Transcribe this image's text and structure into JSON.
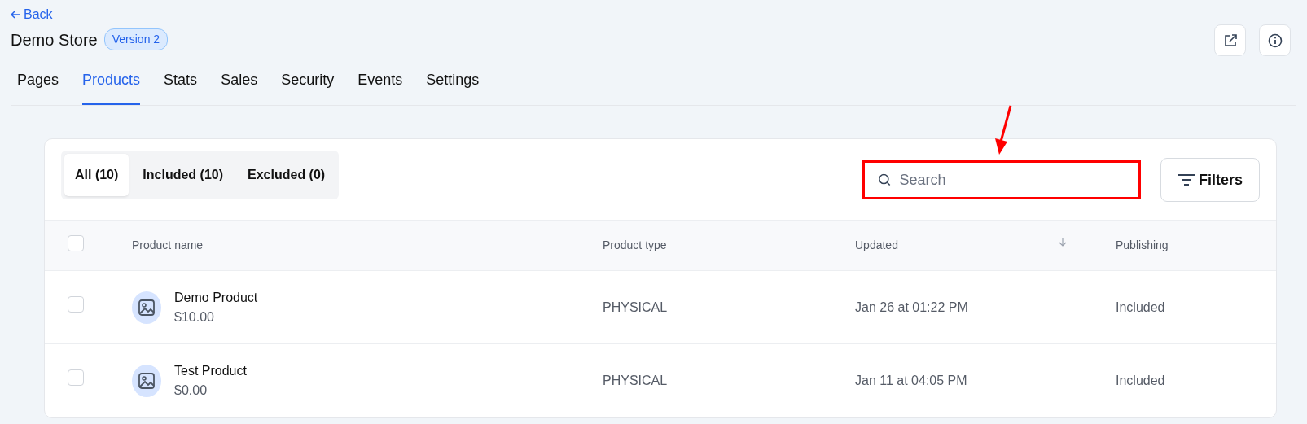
{
  "back_link": "Back",
  "store": {
    "title": "Demo Store",
    "version_badge": "Version 2"
  },
  "tabs": [
    {
      "label": "Pages",
      "selected": false
    },
    {
      "label": "Products",
      "selected": true
    },
    {
      "label": "Stats",
      "selected": false
    },
    {
      "label": "Sales",
      "selected": false
    },
    {
      "label": "Security",
      "selected": false
    },
    {
      "label": "Events",
      "selected": false
    },
    {
      "label": "Settings",
      "selected": false
    }
  ],
  "filter_segments": [
    {
      "label": "All (10)",
      "selected": true
    },
    {
      "label": "Included (10)",
      "selected": false
    },
    {
      "label": "Excluded (0)",
      "selected": false
    }
  ],
  "search": {
    "placeholder": "Search",
    "highlighted": true
  },
  "filters_button": "Filters",
  "table": {
    "select_all_checked": false,
    "columns": [
      "Product name",
      "Product type",
      "Updated",
      "Publishing"
    ],
    "rows": [
      {
        "checked": false,
        "name": "Demo Product",
        "price": "$10.00",
        "type": "PHYSICAL",
        "updated": "Jan 26 at 01:22 PM",
        "publishing": "Included"
      },
      {
        "checked": false,
        "name": "Test Product",
        "price": "$0.00",
        "type": "PHYSICAL",
        "updated": "Jan 11 at 04:05 PM",
        "publishing": "Included"
      }
    ]
  }
}
